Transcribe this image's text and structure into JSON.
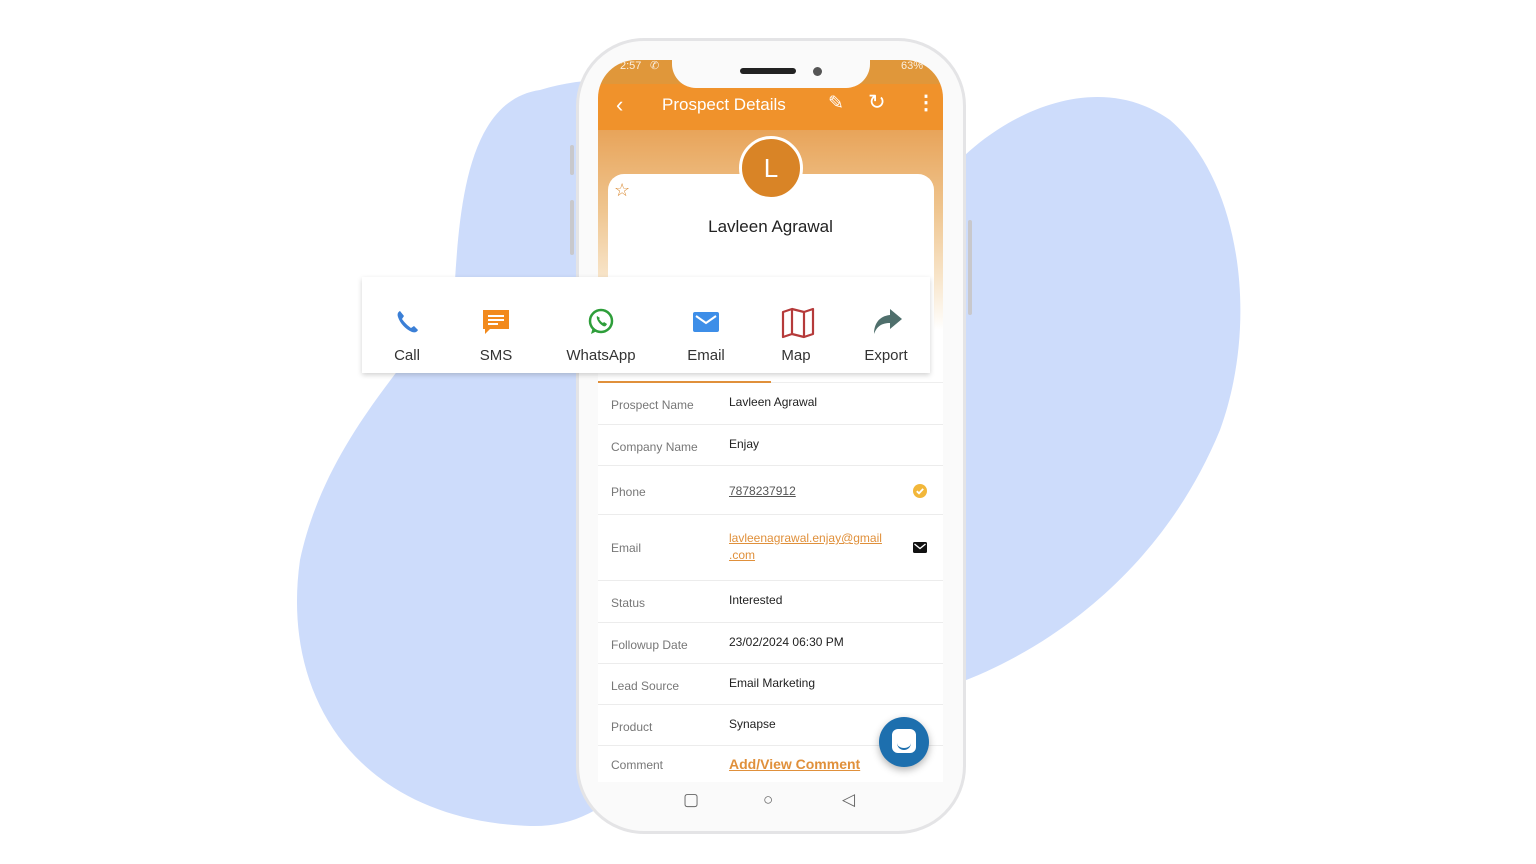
{
  "status_bar": {
    "time": "2:57",
    "battery": "63%"
  },
  "app_bar": {
    "title": "Prospect Details",
    "back_icon": "chevron-left-icon",
    "edit_icon": "pencil-icon",
    "refresh_icon": "refresh-icon",
    "more_icon": "more-vertical-icon"
  },
  "profile": {
    "avatar_initial": "L",
    "name": "Lavleen Agrawal",
    "favorite_icon": "star-outline-icon"
  },
  "actions": [
    {
      "label": "Call",
      "icon": "phone-icon",
      "color": "#3b7fd6"
    },
    {
      "label": "SMS",
      "icon": "sms-icon",
      "color": "#f28a1d"
    },
    {
      "label": "WhatsApp",
      "icon": "whatsapp-icon",
      "color": "#2e9e3a"
    },
    {
      "label": "Email",
      "icon": "email-icon",
      "color": "#3d8ee8"
    },
    {
      "label": "Map",
      "icon": "map-icon",
      "color": "#b53a3a"
    },
    {
      "label": "Export",
      "icon": "share-arrow-icon",
      "color": "#4f6f6c"
    }
  ],
  "details": [
    {
      "label": "Prospect Name",
      "value": "Lavleen Agrawal"
    },
    {
      "label": "Company Name",
      "value": "Enjay"
    },
    {
      "label": "Phone",
      "value": "7878237912",
      "icon": "verified-check-icon"
    },
    {
      "label": "Email",
      "value_line1": "lavleenagrawal.enjay@gmail",
      "value_line2": ".com",
      "icon": "envelope-icon"
    },
    {
      "label": "Status",
      "value": "Interested"
    },
    {
      "label": "Followup Date",
      "value": "23/02/2024 06:30 PM"
    },
    {
      "label": "Lead Source",
      "value": "Email Marketing"
    },
    {
      "label": "Product",
      "value": "Synapse"
    },
    {
      "label": "Comment",
      "value": "Add/View Comment"
    }
  ],
  "colors": {
    "accent": "#f0922b",
    "avatar": "#d98426",
    "link": "#e0903b",
    "fab": "#1d6fae",
    "blob": "#cddcfb"
  }
}
